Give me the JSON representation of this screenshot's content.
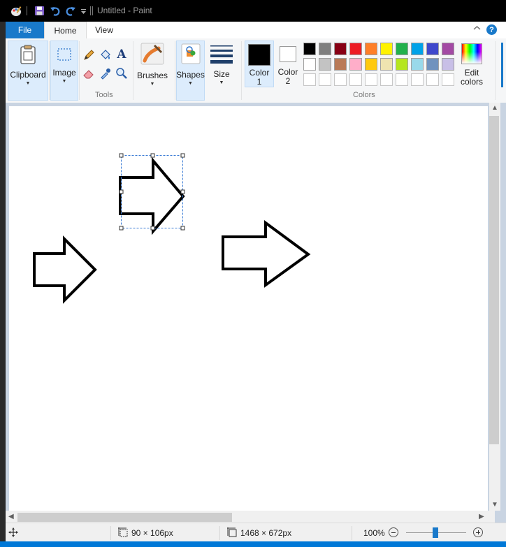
{
  "window": {
    "title": "Untitled - Paint"
  },
  "quick_access": {
    "icons": [
      "paint-app-icon",
      "save-icon",
      "undo-icon",
      "redo-icon",
      "customize-quick-access-icon"
    ]
  },
  "tabs": [
    {
      "label": "File",
      "active": false
    },
    {
      "label": "Home",
      "active": true
    },
    {
      "label": "View",
      "active": false
    }
  ],
  "ribbon": {
    "clipboard": {
      "label": "Clipboard"
    },
    "image": {
      "label": "Image"
    },
    "tools": {
      "label": "Tools",
      "icons": [
        "pencil-icon",
        "fill-bucket-icon",
        "text-icon",
        "eraser-icon",
        "color-picker-icon",
        "magnifier-icon"
      ]
    },
    "brushes": {
      "label": "Brushes"
    },
    "shapes": {
      "label": "Shapes"
    },
    "size": {
      "label": "Size"
    },
    "color1": {
      "label_line1": "Color",
      "label_line2": "1",
      "value": "#000000"
    },
    "color2": {
      "label_line1": "Color",
      "label_line2": "2",
      "value": "#ffffff"
    },
    "colors_group_label": "Colors",
    "palette_row1": [
      "#000000",
      "#7f7f7f",
      "#880015",
      "#ed1c24",
      "#ff7f27",
      "#fff200",
      "#22b14c",
      "#00a2e8",
      "#3f48cc",
      "#a349a4"
    ],
    "palette_row2": [
      "#ffffff",
      "#c3c3c3",
      "#b97a57",
      "#ffaec9",
      "#ffc90e",
      "#efe4b0",
      "#b5e61d",
      "#99d9ea",
      "#7092be",
      "#c8bfe7"
    ],
    "palette_row3_empty_count": 10,
    "edit_colors": {
      "label_line1": "Edit",
      "label_line2": "colors"
    }
  },
  "status": {
    "selection_size": "90 × 106px",
    "canvas_size": "1468 × 672px",
    "zoom": "100%",
    "zoom_level": 1.0
  },
  "accent_color": "#1979ca"
}
